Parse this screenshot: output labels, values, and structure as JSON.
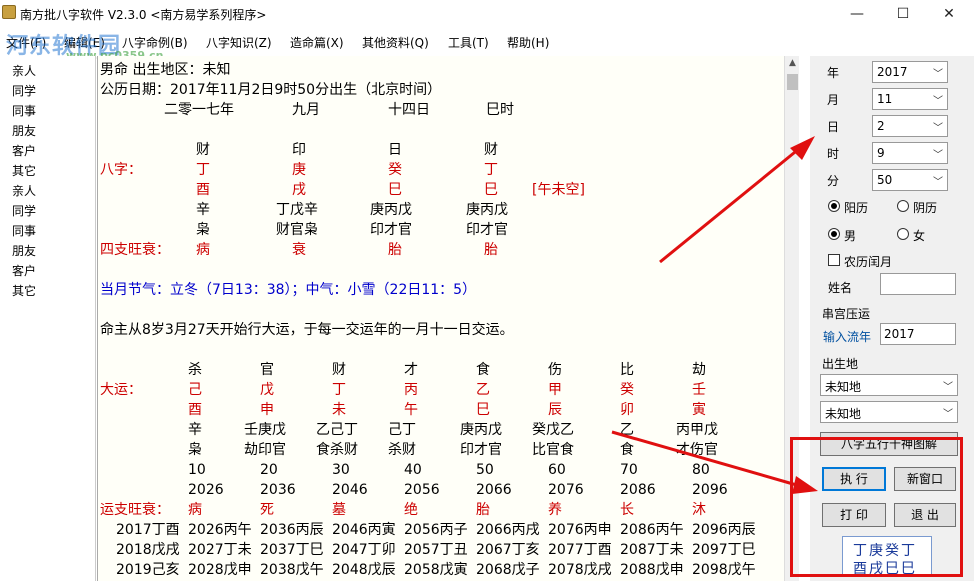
{
  "window": {
    "title": "南方批八字软件 V2.3.0 <南方易学系列程序>",
    "min": "—",
    "max": "☐",
    "close": "✕"
  },
  "menu": [
    "文件(F)",
    "编辑(E)",
    "八字命例(B)",
    "八字知识(Z)",
    "造命篇(X)",
    "其他资料(Q)",
    "工具(T)",
    "帮助(H)"
  ],
  "watermark": {
    "name": "河东软件园",
    "url": "www.pc0359.cn"
  },
  "left_list": [
    "亲人",
    "同学",
    "同事",
    "朋友",
    "客户",
    "其它",
    "亲人",
    "同学",
    "同事",
    "朋友",
    "客户",
    "其它"
  ],
  "chart": {
    "line1": "男命        出生地区：未知",
    "line2": "公历日期：2017年11月2日9时50分出生（北京时间）",
    "lunar": [
      "二零一七年",
      "九月",
      "十四日",
      "巳时"
    ],
    "gods": [
      "财",
      "印",
      "日",
      "财"
    ],
    "bazi_label": "八字：",
    "stems": [
      "丁",
      "庚",
      "癸",
      "丁"
    ],
    "branches": [
      "酉",
      "戌",
      "巳",
      "巳"
    ],
    "kongwang": "[午未空]",
    "hidden1": [
      "辛",
      "丁戊辛",
      "庚丙戊",
      "庚丙戊"
    ],
    "hidden2": [
      "枭",
      "财官枭",
      "印才官",
      "印才官"
    ],
    "wang_label": "四支旺衰：",
    "wang": [
      "病",
      "衰",
      "胎",
      "胎"
    ],
    "jieqi": "当月节气：立冬（7日13：38）；中气：小雪（22日11：5）",
    "dayun_intro": "命主从8岁3月27天开始行大运，于每一交运年的一月十一日交运。",
    "dy_gods": [
      "杀",
      "官",
      "财",
      "才",
      "食",
      "伤",
      "比",
      "劫"
    ],
    "dy_label": "大运：",
    "dy_stems": [
      "己",
      "戊",
      "丁",
      "丙",
      "乙",
      "甲",
      "癸",
      "壬"
    ],
    "dy_branches": [
      "酉",
      "申",
      "未",
      "午",
      "巳",
      "辰",
      "卯",
      "寅"
    ],
    "dy_hidden1": [
      "辛",
      "壬庚戊",
      "乙己丁",
      "己丁",
      "庚丙戊",
      "癸戊乙",
      "乙",
      "丙甲戊"
    ],
    "dy_hidden2": [
      "枭",
      "劫印官",
      "食杀财",
      "杀财",
      "印才官",
      "比官食",
      "食",
      "才伤官"
    ],
    "dy_ages": [
      "10",
      "20",
      "30",
      "40",
      "50",
      "60",
      "70",
      "80"
    ],
    "dy_years": [
      "2026",
      "2036",
      "2046",
      "2056",
      "2066",
      "2076",
      "2086",
      "2096"
    ],
    "yz_label": "运支旺衰：",
    "yz": [
      "病",
      "死",
      "墓",
      "绝",
      "胎",
      "养",
      "长",
      "沐"
    ],
    "ln_rows": [
      [
        "2017丁酉",
        "2026丙午",
        "2036丙辰",
        "2046丙寅",
        "2056丙子",
        "2066丙戌",
        "2076丙申",
        "2086丙午",
        "2096丙辰"
      ],
      [
        "2018戊戌",
        "2027丁未",
        "2037丁巳",
        "2047丁卯",
        "2057丁丑",
        "2067丁亥",
        "2077丁酉",
        "2087丁未",
        "2097丁巳"
      ],
      [
        "2019己亥",
        "2028戊申",
        "2038戊午",
        "2048戊辰",
        "2058戊寅",
        "2068戊子",
        "2078戊戌",
        "2088戊申",
        "2098戊午"
      ]
    ]
  },
  "panel": {
    "year_label": "年",
    "year": "2017",
    "month_label": "月",
    "month": "11",
    "day_label": "日",
    "day": "2",
    "hour_label": "时",
    "hour": "9",
    "minute_label": "分",
    "minute": "50",
    "solar": "阳历",
    "lunar": "阴历",
    "male": "男",
    "female": "女",
    "leap": "农历闰月",
    "name_label": "姓名",
    "group1": "串宫压运",
    "liunian_label": "输入流年",
    "liunian": "2017",
    "group2": "出生地",
    "place1": "未知地",
    "place2": "未知地",
    "btn_chart": "八字五行十神图解",
    "btn_exec": "执 行",
    "btn_newwin": "新窗口",
    "btn_print": "打 印",
    "btn_exit": "退 出",
    "summary1": "丁庚癸丁",
    "summary2": "酉戌巳巳"
  },
  "colors": {
    "red": "#cc0000",
    "blue": "#0000cc",
    "annot": "#e01010"
  }
}
